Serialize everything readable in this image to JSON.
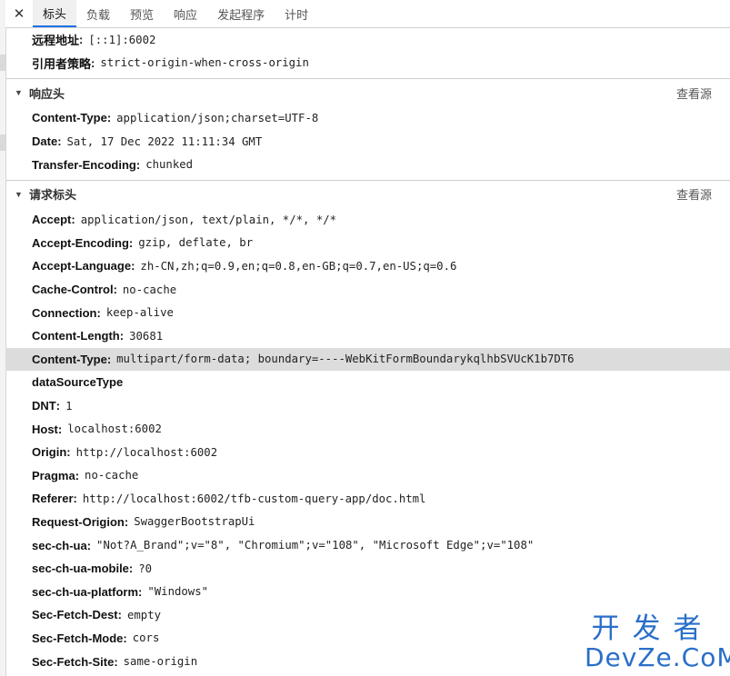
{
  "tabs": {
    "close_symbol": "✕",
    "items": [
      "标头",
      "负载",
      "预览",
      "响应",
      "发起程序",
      "计时"
    ],
    "active": "标头"
  },
  "general": [
    {
      "key": "远程地址",
      "value": "[::1]:6002"
    },
    {
      "key": "引用者策略",
      "value": "strict-origin-when-cross-origin"
    }
  ],
  "response_headers": {
    "title": "响应头",
    "view_source": "查看源",
    "rows": [
      {
        "key": "Content-Type",
        "value": "application/json;charset=UTF-8"
      },
      {
        "key": "Date",
        "value": "Sat, 17 Dec 2022 11:11:34 GMT"
      },
      {
        "key": "Transfer-Encoding",
        "value": "chunked"
      }
    ]
  },
  "request_headers": {
    "title": "请求标头",
    "view_source": "查看源",
    "rows": [
      {
        "key": "Accept",
        "value": "application/json, text/plain, */*, */*"
      },
      {
        "key": "Accept-Encoding",
        "value": "gzip, deflate, br"
      },
      {
        "key": "Accept-Language",
        "value": "zh-CN,zh;q=0.9,en;q=0.8,en-GB;q=0.7,en-US;q=0.6"
      },
      {
        "key": "Cache-Control",
        "value": "no-cache"
      },
      {
        "key": "Connection",
        "value": "keep-alive"
      },
      {
        "key": "Content-Length",
        "value": "30681"
      },
      {
        "key": "Content-Type",
        "value": "multipart/form-data; boundary=----WebKitFormBoundarykqlhbSVUcK1b7DT6"
      },
      {
        "key": "dataSourceType",
        "value": ""
      },
      {
        "key": "DNT",
        "value": "1"
      },
      {
        "key": "Host",
        "value": "localhost:6002"
      },
      {
        "key": "Origin",
        "value": "http://localhost:6002"
      },
      {
        "key": "Pragma",
        "value": "no-cache"
      },
      {
        "key": "Referer",
        "value": "http://localhost:6002/tfb-custom-query-app/doc.html"
      },
      {
        "key": "Request-Origion",
        "value": "SwaggerBootstrapUi"
      },
      {
        "key": "sec-ch-ua",
        "value": "\"Not?A_Brand\";v=\"8\", \"Chromium\";v=\"108\", \"Microsoft Edge\";v=\"108\""
      },
      {
        "key": "sec-ch-ua-mobile",
        "value": "?0"
      },
      {
        "key": "sec-ch-ua-platform",
        "value": "\"Windows\""
      },
      {
        "key": "Sec-Fetch-Dest",
        "value": "empty"
      },
      {
        "key": "Sec-Fetch-Mode",
        "value": "cors"
      },
      {
        "key": "Sec-Fetch-Site",
        "value": "same-origin"
      }
    ]
  },
  "watermark": {
    "top": "开发者",
    "bottom": "DevZe.CoM"
  }
}
